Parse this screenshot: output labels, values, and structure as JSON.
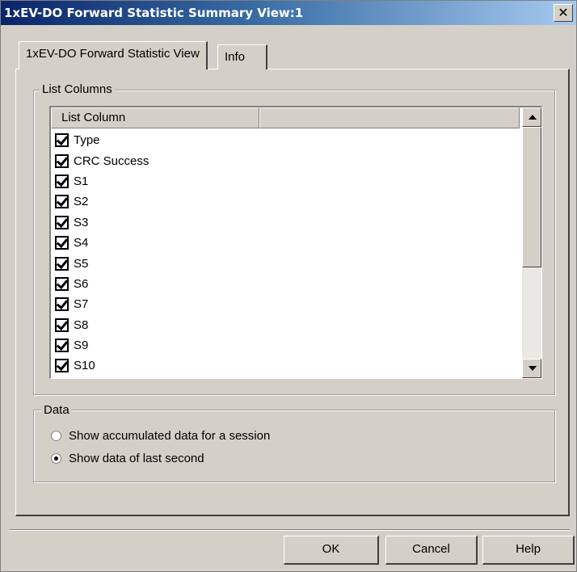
{
  "window": {
    "title": "1xEV-DO Forward Statistic Summary View:1",
    "close_glyph": "✕"
  },
  "tabs": [
    {
      "label": "1xEV-DO Forward Statistic View",
      "active": true
    },
    {
      "label": "Info",
      "active": false
    }
  ],
  "list_columns": {
    "group_title": "List Columns",
    "header": "List Column",
    "items": [
      {
        "label": "Type",
        "checked": true
      },
      {
        "label": "CRC Success",
        "checked": true
      },
      {
        "label": "S1",
        "checked": true
      },
      {
        "label": "S2",
        "checked": true
      },
      {
        "label": "S3",
        "checked": true
      },
      {
        "label": "S4",
        "checked": true
      },
      {
        "label": "S5",
        "checked": true
      },
      {
        "label": "S6",
        "checked": true
      },
      {
        "label": "S7",
        "checked": true
      },
      {
        "label": "S8",
        "checked": true
      },
      {
        "label": "S9",
        "checked": true
      },
      {
        "label": "S10",
        "checked": true
      }
    ]
  },
  "data_group": {
    "title": "Data",
    "options": [
      {
        "label": "Show accumulated data for a session",
        "selected": false
      },
      {
        "label": "Show data of last second",
        "selected": true
      }
    ]
  },
  "buttons": {
    "ok": "OK",
    "cancel": "Cancel",
    "help": "Help"
  }
}
